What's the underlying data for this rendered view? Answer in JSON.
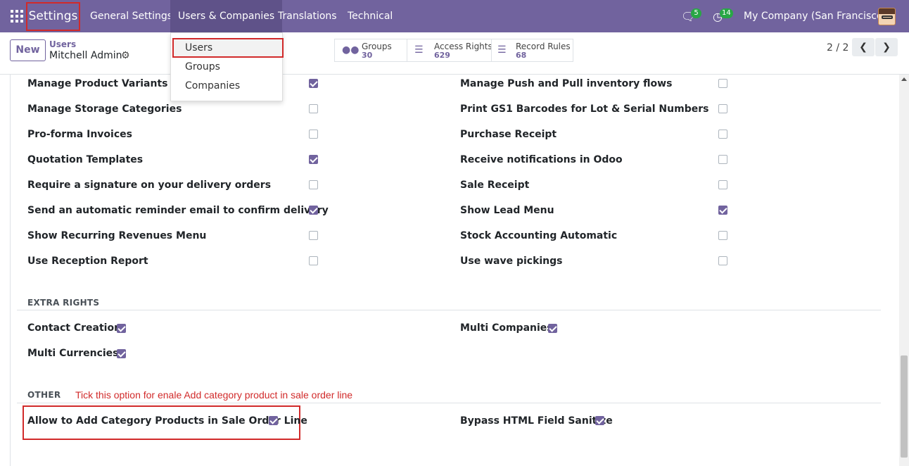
{
  "navbar": {
    "brand": "Settings",
    "menu": [
      "General Settings",
      "Users & Companies",
      "Translations",
      "Technical"
    ],
    "messages_count": "5",
    "activities_count": "14",
    "company": "My Company (San Francisco)"
  },
  "dropdown": {
    "items": [
      "Users",
      "Groups",
      "Companies"
    ]
  },
  "control": {
    "new_label": "New",
    "breadcrumb_parent": "Users",
    "record_name": "Mitchell Admin",
    "smart_buttons": [
      {
        "label": "Groups",
        "value": "30"
      },
      {
        "label": "Access Rights",
        "value": "629"
      },
      {
        "label": "Record Rules",
        "value": "68"
      }
    ],
    "pager": "2 / 2"
  },
  "rights": {
    "left": [
      {
        "label": "Manage Product Variants",
        "checked": true
      },
      {
        "label": "Manage Storage Categories",
        "checked": false
      },
      {
        "label": "Pro-forma Invoices",
        "checked": false
      },
      {
        "label": "Quotation Templates",
        "checked": true
      },
      {
        "label": "Require a signature on your delivery orders",
        "checked": false
      },
      {
        "label": "Send an automatic reminder email to confirm delivery",
        "checked": true
      },
      {
        "label": "Show Recurring Revenues Menu",
        "checked": false
      },
      {
        "label": "Use Reception Report",
        "checked": false
      }
    ],
    "right": [
      {
        "label": "Manage Push and Pull inventory flows",
        "checked": false
      },
      {
        "label": "Print GS1 Barcodes for Lot & Serial Numbers",
        "checked": false
      },
      {
        "label": "Purchase Receipt",
        "checked": false
      },
      {
        "label": "Receive notifications in Odoo",
        "checked": false
      },
      {
        "label": "Sale Receipt",
        "checked": false
      },
      {
        "label": "Show Lead Menu",
        "checked": true
      },
      {
        "label": "Stock Accounting Automatic",
        "checked": false
      },
      {
        "label": "Use wave pickings",
        "checked": false
      }
    ]
  },
  "extra_rights": {
    "title": "EXTRA RIGHTS",
    "items": [
      {
        "label": "Contact Creation",
        "checked": true
      },
      {
        "label": "Multi Companies",
        "checked": true
      },
      {
        "label": "Multi Currencies",
        "checked": true
      }
    ]
  },
  "other": {
    "title": "OTHER",
    "note": "Tick this option for enale Add category product in sale order line",
    "items": [
      {
        "label": "Allow to Add Category Products in Sale Order Line",
        "checked": true
      },
      {
        "label": "Bypass HTML Field Sanitize",
        "checked": true
      }
    ]
  },
  "colors": {
    "brand": "#71639e",
    "highlight": "#d12a2a",
    "badge": "#28a745"
  }
}
